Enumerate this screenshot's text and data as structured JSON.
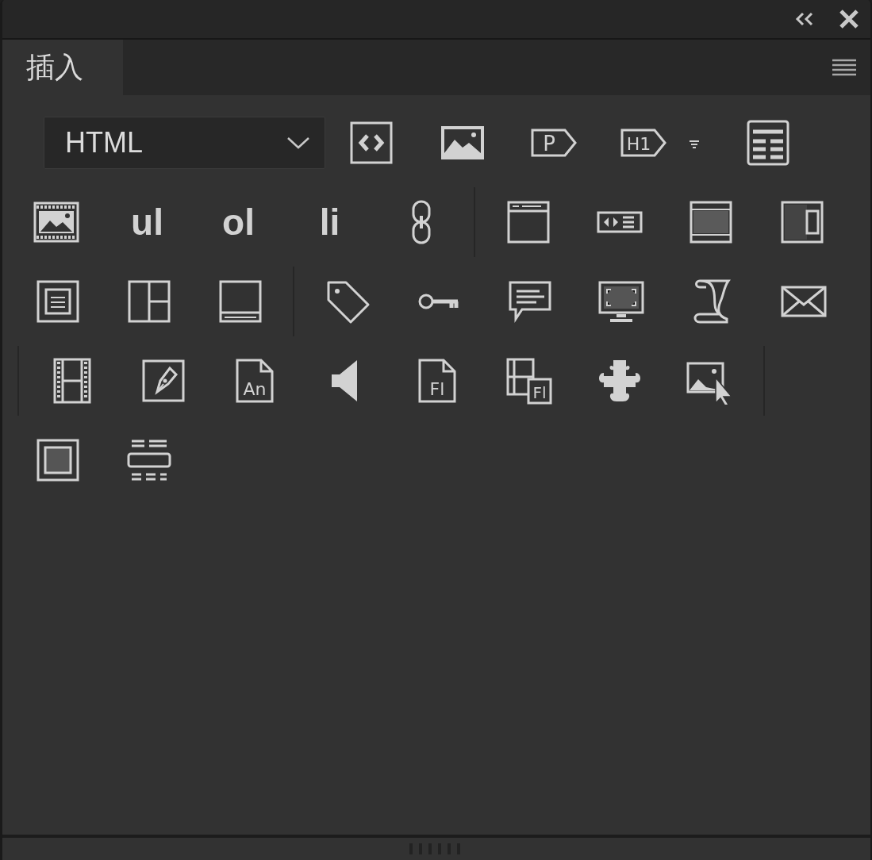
{
  "tabs": [
    {
      "label": "插入",
      "selected": true
    }
  ],
  "rows": [
    {
      "items": [
        {
          "kind": "select",
          "value": "HTML"
        },
        {
          "kind": "icon"
        },
        {
          "kind": "icon"
        },
        {
          "kind": "icon",
          "label": "P"
        },
        {
          "kind": "icon",
          "label": "H1"
        },
        {
          "kind": "icon"
        }
      ]
    },
    {
      "items": [
        {
          "kind": "icon"
        },
        {
          "kind": "text",
          "label": "ul"
        },
        {
          "kind": "text",
          "label": "ol"
        },
        {
          "kind": "text",
          "label": "li"
        },
        {
          "kind": "icon"
        },
        {
          "kind": "divider"
        },
        {
          "kind": "icon"
        },
        {
          "kind": "icon"
        },
        {
          "kind": "icon"
        },
        {
          "kind": "icon"
        }
      ]
    },
    {
      "items": [
        {
          "kind": "icon"
        },
        {
          "kind": "icon"
        },
        {
          "kind": "icon"
        },
        {
          "kind": "divider"
        },
        {
          "kind": "icon"
        },
        {
          "kind": "icon"
        },
        {
          "kind": "icon"
        },
        {
          "kind": "icon"
        },
        {
          "kind": "icon"
        },
        {
          "kind": "icon"
        }
      ]
    },
    {
      "items": [
        {
          "kind": "divider"
        },
        {
          "kind": "icon"
        },
        {
          "kind": "icon"
        },
        {
          "kind": "icon",
          "label": "An"
        },
        {
          "kind": "icon"
        },
        {
          "kind": "icon",
          "label": "Fl"
        },
        {
          "kind": "icon",
          "label": "Fl"
        },
        {
          "kind": "icon"
        },
        {
          "kind": "icon"
        },
        {
          "kind": "divider"
        }
      ]
    },
    {
      "items": [
        {
          "kind": "icon"
        },
        {
          "kind": "icon"
        }
      ]
    }
  ]
}
